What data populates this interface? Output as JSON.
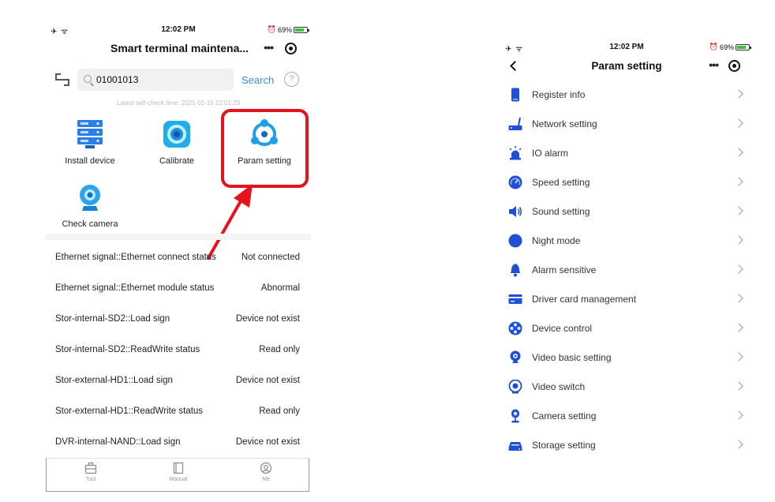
{
  "left": {
    "status": {
      "signal": "✈ ᯤ",
      "time": "12:02 PM",
      "alarm": "⏰",
      "battery": "69%"
    },
    "nav": {
      "title": "Smart terminal maintena...",
      "more": "•••"
    },
    "search": {
      "value": "01001013",
      "button": "Search",
      "help": "?"
    },
    "selfcheck": "Latest self-check time: 2021-01-15 12:01:29",
    "grid": [
      {
        "label": "Install device",
        "icon": "server-icon"
      },
      {
        "label": "Calibrate",
        "icon": "calibrate-icon"
      },
      {
        "label": "Param setting",
        "icon": "param-icon"
      },
      {
        "label": "Check camera",
        "icon": "camera-icon"
      }
    ],
    "status_rows": [
      {
        "key": "Ethernet signal::Ethernet connect status",
        "value": "Not connected"
      },
      {
        "key": "Ethernet signal::Ethernet module status",
        "value": "Abnormal"
      },
      {
        "key": "Stor-internal-SD2::Load sign",
        "value": "Device not exist"
      },
      {
        "key": "Stor-internal-SD2::ReadWrite status",
        "value": "Read only"
      },
      {
        "key": "Stor-external-HD1::Load sign",
        "value": "Device not exist"
      },
      {
        "key": "Stor-external-HD1::ReadWrite status",
        "value": "Read only"
      },
      {
        "key": "DVR-internal-NAND::Load sign",
        "value": "Device not exist"
      }
    ],
    "tabs": [
      {
        "label": "Tool",
        "icon": "toolbox-icon"
      },
      {
        "label": "Manual",
        "icon": "book-icon"
      },
      {
        "label": "Me",
        "icon": "user-icon"
      }
    ]
  },
  "right": {
    "status": {
      "signal": "✈ ᯤ",
      "time": "12:02 PM",
      "alarm": "⏰",
      "battery": "69%"
    },
    "nav": {
      "title": "Param setting",
      "more": "•••"
    },
    "menu": [
      {
        "label": "Register info",
        "icon": "phone-icon"
      },
      {
        "label": "Network setting",
        "icon": "router-icon"
      },
      {
        "label": "IO alarm",
        "icon": "siren-icon"
      },
      {
        "label": "Speed setting",
        "icon": "speedometer-icon"
      },
      {
        "label": "Sound setting",
        "icon": "speaker-icon"
      },
      {
        "label": "Night mode",
        "icon": "moon-icon"
      },
      {
        "label": "Alarm sensitive",
        "icon": "bell-icon"
      },
      {
        "label": "Driver card management",
        "icon": "card-icon"
      },
      {
        "label": "Device control",
        "icon": "control-icon"
      },
      {
        "label": "Video basic setting",
        "icon": "webcam-icon"
      },
      {
        "label": "Video switch",
        "icon": "video-switch-icon"
      },
      {
        "label": "Camera setting",
        "icon": "camera-icon"
      },
      {
        "label": "Storage setting",
        "icon": "storage-icon"
      }
    ]
  },
  "colors": {
    "accent": "#3a8ee6",
    "icon_blue": "#1f4fd6",
    "highlight_red": "#e3141b"
  }
}
